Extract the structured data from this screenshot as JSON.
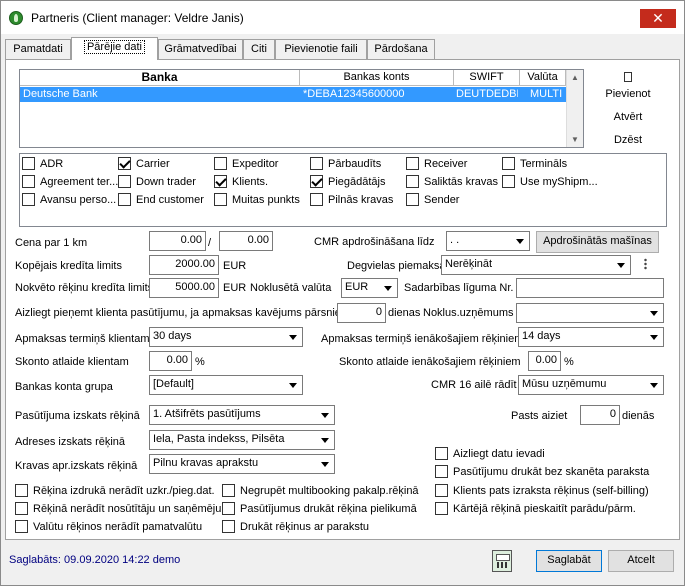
{
  "window": {
    "title": "Partneris (Client manager: Veldre Janis)",
    "close": "✕"
  },
  "tabs": [
    "Pamatdati",
    "Pārējie dati",
    "Grāmatvedībai",
    "Citi",
    "Pievienotie faili",
    "Pārdošana"
  ],
  "active_tab": "Pārējie dati",
  "banks": {
    "columns": [
      "Banka",
      "Bankas konts",
      "SWIFT",
      "Valūta"
    ],
    "rows": [
      {
        "bank": "Deutsche Bank",
        "account": "*DEBA12345600000",
        "swift": "DEUTDEDBDU",
        "currency": "MULTI"
      }
    ],
    "add": "Pievienot",
    "open": "Atvērt",
    "delete": "Dzēst"
  },
  "flags": [
    {
      "label": "ADR",
      "checked": false
    },
    {
      "label": "Carrier",
      "checked": true
    },
    {
      "label": "Expeditor",
      "checked": false
    },
    {
      "label": "Pārbaudīts",
      "checked": false
    },
    {
      "label": "Receiver",
      "checked": false
    },
    {
      "label": "Termināls",
      "checked": false
    },
    {
      "label": "Agreement ter...",
      "checked": false
    },
    {
      "label": "Down trader",
      "checked": false
    },
    {
      "label": "Klients.",
      "checked": true
    },
    {
      "label": "Piegādātājs",
      "checked": true
    },
    {
      "label": "Saliktās kravas",
      "checked": false
    },
    {
      "label": "Use myShipm...",
      "checked": false
    },
    {
      "label": "Avansu perso...",
      "checked": false
    },
    {
      "label": "End customer",
      "checked": false
    },
    {
      "label": "Muitas punkts",
      "checked": false
    },
    {
      "label": "Pilnās kravas",
      "checked": false
    },
    {
      "label": "Sender",
      "checked": false
    }
  ],
  "form": {
    "price_per_km_label": "Cena par 1 km",
    "price_per_km_1": "0.00",
    "price_sep": "/",
    "price_per_km_2": "0.00",
    "cmr_insurance_label": "CMR apdrošināšana līdz",
    "cmr_insurance_value": ". .",
    "insured_vehicles_btn": "Apdrošinātās mašīnas",
    "total_credit_label": "Kopējais kredīta limits",
    "total_credit_value": "2000.00",
    "total_credit_currency": "EUR",
    "fuel_payment_label": "Degvielas piemaksa",
    "fuel_payment_value": "Nerēķināt",
    "overdue_credit_label": "Nokvēto rēķinu kredīta limits",
    "overdue_credit_value": "5000.00",
    "overdue_credit_currency": "EUR",
    "default_currency_label": "Noklusētā valūta",
    "default_currency_value": "EUR",
    "agreement_no_label": "Sadarbības līguma Nr.",
    "agreement_no_value": "",
    "deny_orders_label": "Aizliegt pieņemt klienta pasūtījumu, ja apmaksas kavējums pārsniedz",
    "deny_orders_days": "0",
    "deny_orders_unit": "dienas",
    "default_company_label": "Noklus.uzņēmums",
    "default_company_value": "",
    "client_term_label": "Apmaksas termiņš klientam",
    "client_term_value": "30 days",
    "incoming_term_label": "Apmaksas termiņš ienākošajiem rēķiniem",
    "incoming_term_value": "14 days",
    "client_discount_label": "Skonto atlaide klientam",
    "client_discount_value": "0.00",
    "percent": "%",
    "incoming_discount_label": "Skonto atlaide ienākošajiem rēķiniem",
    "incoming_discount_value": "0.00",
    "bank_group_label": "Bankas konta grupa",
    "bank_group_value": "[Default]",
    "cmr16_label": "CMR 16 ailē rādīt",
    "cmr16_value": "Mūsu uzņēmumu",
    "order_display_label": "Pasūtījuma izskats rēķinā",
    "order_display_value": "1. Atšifrēts pasūtījums",
    "mail_out_label": "Pasts aiziet",
    "mail_out_value": "0",
    "mail_out_unit": "dienās",
    "address_display_label": "Adreses izskats rēķinā",
    "address_display_value": "Iela, Pasta indekss, Pilsēta",
    "cargo_display_label": "Kravas apr.izskats rēķinā",
    "cargo_display_value": "Pilnu kravas aprakstu"
  },
  "options_right": [
    {
      "label": "Aizliegt datu ievadi",
      "checked": false
    },
    {
      "label": "Pasūtījumu drukāt bez skanēta paraksta",
      "checked": false
    },
    {
      "label": "Klients pats izraksta rēķinus (self-billing)",
      "checked": false
    },
    {
      "label": "Kārtējā rēķinā pieskaitīt parādu/pārm.",
      "checked": false
    }
  ],
  "options_bottom": [
    {
      "label": "Rēķina izdrukā nerādīt uzkr./pieg.dat.",
      "checked": false
    },
    {
      "label": "Negrupēt multibooking pakalp.rēķinā",
      "checked": false
    },
    {
      "label": "Rēķinā nerādīt nosūtītāju un saņēmēju",
      "checked": false
    },
    {
      "label": "Pasūtījumus drukāt rēķina pielikumā",
      "checked": false
    },
    {
      "label": "Valūtu rēķinos nerādīt pamatvalūtu",
      "checked": false
    },
    {
      "label": "Drukāt rēķinus ar parakstu",
      "checked": false
    }
  ],
  "footer": {
    "status": "Saglabāts: 09.09.2020 14:22 demo",
    "save": "Saglabāt",
    "cancel": "Atcelt"
  }
}
